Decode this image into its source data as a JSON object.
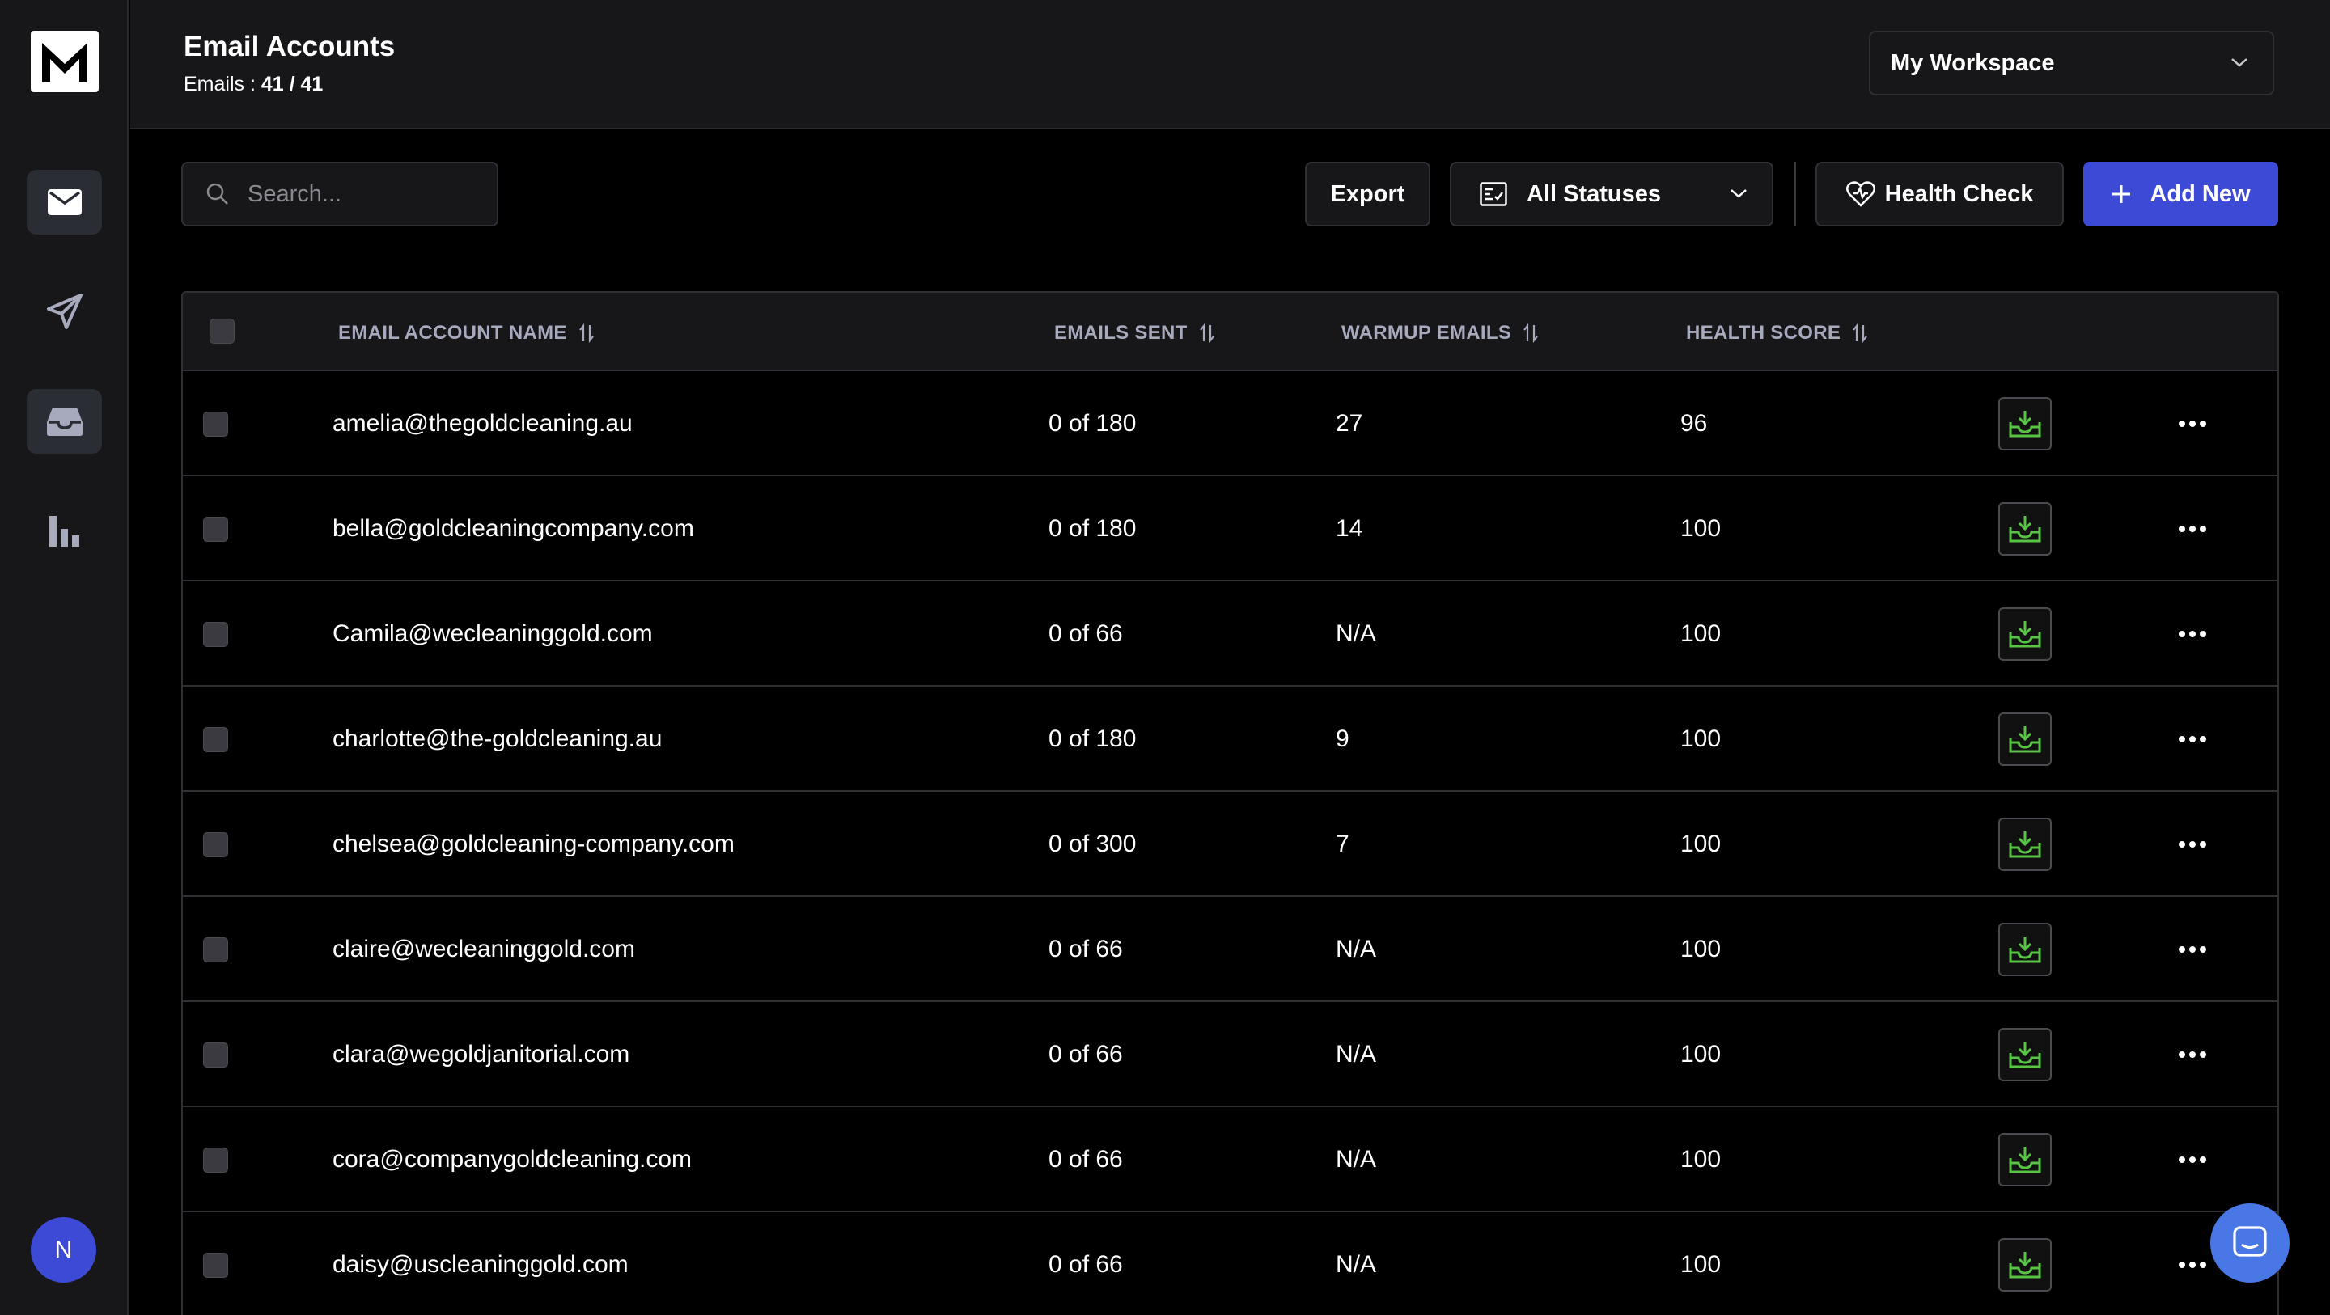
{
  "header": {
    "title": "Email Accounts",
    "emails_label": "Emails :",
    "emails_value": "41 / 41",
    "workspace": "My Workspace"
  },
  "sidebar": {
    "items": [
      {
        "icon": "mail-icon",
        "active": true
      },
      {
        "icon": "send-icon",
        "active": false
      },
      {
        "icon": "inbox-icon",
        "active": true
      },
      {
        "icon": "bar-chart-icon",
        "active": false
      }
    ],
    "avatar_initial": "N"
  },
  "toolbar": {
    "search_placeholder": "Search...",
    "export_label": "Export",
    "status_label": "All Statuses",
    "health_label": "Health Check",
    "add_label": "Add New"
  },
  "colors": {
    "accent": "#3c4ad6",
    "inbox_green": "#57c443",
    "header_text": "#a7a9bd",
    "chat_blue": "#4a77e6"
  },
  "table": {
    "columns": [
      "EMAIL ACCOUNT NAME",
      "EMAILS SENT",
      "WARMUP EMAILS",
      "HEALTH SCORE"
    ],
    "rows": [
      {
        "email": "amelia@thegoldcleaning.au",
        "sent": "0 of 180",
        "warmup": "27",
        "health": "96"
      },
      {
        "email": "bella@goldcleaningcompany.com",
        "sent": "0 of 180",
        "warmup": "14",
        "health": "100"
      },
      {
        "email": "Camila@wecleaninggold.com",
        "sent": "0 of 66",
        "warmup": "N/A",
        "health": "100"
      },
      {
        "email": "charlotte@the-goldcleaning.au",
        "sent": "0 of 180",
        "warmup": "9",
        "health": "100"
      },
      {
        "email": "chelsea@goldcleaning-company.com",
        "sent": "0 of 300",
        "warmup": "7",
        "health": "100"
      },
      {
        "email": "claire@wecleaninggold.com",
        "sent": "0 of 66",
        "warmup": "N/A",
        "health": "100"
      },
      {
        "email": "clara@wegoldjanitorial.com",
        "sent": "0 of 66",
        "warmup": "N/A",
        "health": "100"
      },
      {
        "email": "cora@companygoldcleaning.com",
        "sent": "0 of 66",
        "warmup": "N/A",
        "health": "100"
      },
      {
        "email": "daisy@uscleaninggold.com",
        "sent": "0 of 66",
        "warmup": "N/A",
        "health": "100"
      }
    ]
  }
}
